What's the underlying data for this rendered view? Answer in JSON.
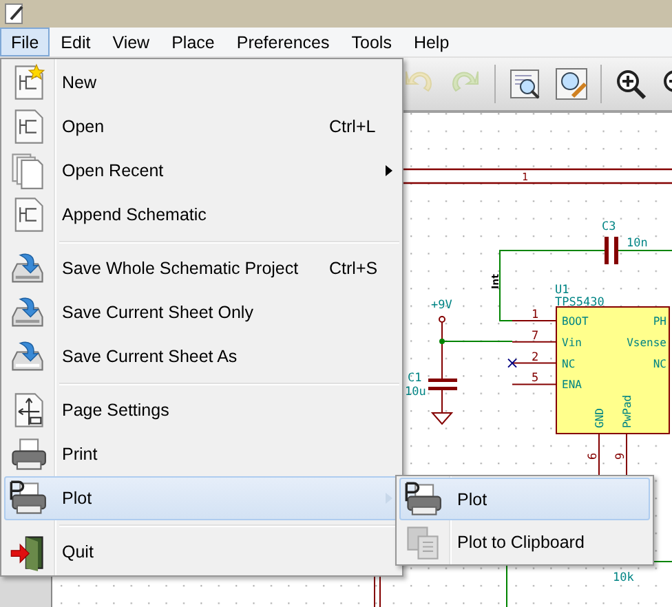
{
  "menu_bar": [
    {
      "label": "File",
      "selected": true
    },
    {
      "label": "Edit",
      "selected": false
    },
    {
      "label": "View",
      "selected": false
    },
    {
      "label": "Place",
      "selected": false
    },
    {
      "label": "Preferences",
      "selected": false
    },
    {
      "label": "Tools",
      "selected": false
    },
    {
      "label": "Help",
      "selected": false
    }
  ],
  "toolbar": [
    {
      "kind": "button",
      "disabled": true
    },
    {
      "kind": "button",
      "disabled": true
    },
    {
      "kind": "separator"
    },
    {
      "kind": "button",
      "disabled": false
    },
    {
      "kind": "button",
      "disabled": false
    },
    {
      "kind": "separator"
    },
    {
      "kind": "button",
      "disabled": false
    },
    {
      "kind": "button",
      "disabled": false
    }
  ],
  "file_menu": [
    {
      "kind": "item",
      "label": "New",
      "selected": false,
      "has_submenu": false
    },
    {
      "kind": "item",
      "label": "Open",
      "shortcut": "Ctrl+L",
      "selected": false,
      "has_submenu": false
    },
    {
      "kind": "item",
      "label": "Open Recent",
      "selected": false,
      "has_submenu": true
    },
    {
      "kind": "item",
      "label": "Append Schematic",
      "selected": false,
      "has_submenu": false
    },
    {
      "kind": "separator"
    },
    {
      "kind": "item",
      "label": "Save Whole Schematic Project",
      "shortcut": "Ctrl+S",
      "selected": false,
      "has_submenu": false
    },
    {
      "kind": "item",
      "label": "Save Current Sheet Only",
      "selected": false,
      "has_submenu": false
    },
    {
      "kind": "item",
      "label": "Save Current Sheet As",
      "selected": false,
      "has_submenu": false
    },
    {
      "kind": "separator"
    },
    {
      "kind": "item",
      "label": "Page Settings",
      "selected": false,
      "has_submenu": false
    },
    {
      "kind": "item",
      "label": "Print",
      "selected": false,
      "has_submenu": false
    },
    {
      "kind": "item",
      "label": "Plot",
      "selected": true,
      "has_submenu": true
    },
    {
      "kind": "separator"
    },
    {
      "kind": "item",
      "label": "Quit",
      "selected": false,
      "has_submenu": false
    }
  ],
  "plot_submenu": [
    {
      "label": "Plot",
      "selected": true
    },
    {
      "label": "Plot to Clipboard",
      "selected": false
    }
  ],
  "schematic": {
    "sheet_pin": "1",
    "net_label": "Int",
    "power": "+9V",
    "resistor_value": "10k",
    "c3": {
      "ref": "C3",
      "value": "10n"
    },
    "c1": {
      "ref": "C1",
      "value": "10u"
    },
    "u1": {
      "ref": "U1",
      "value": "TPS5430",
      "left_pins": [
        {
          "number": "1",
          "name": "BOOT",
          "no_connect": false
        },
        {
          "number": "7",
          "name": "Vin",
          "no_connect": false
        },
        {
          "number": "2",
          "name": "NC",
          "no_connect": true
        },
        {
          "number": "5",
          "name": "ENA",
          "no_connect": false
        }
      ],
      "right_pins": [
        {
          "name": "PH"
        },
        {
          "name": "Vsense"
        },
        {
          "name": "NC"
        }
      ],
      "bottom_pins": [
        {
          "number": "6",
          "name": "GND"
        },
        {
          "number": "9",
          "name": "PwPad"
        }
      ]
    }
  }
}
